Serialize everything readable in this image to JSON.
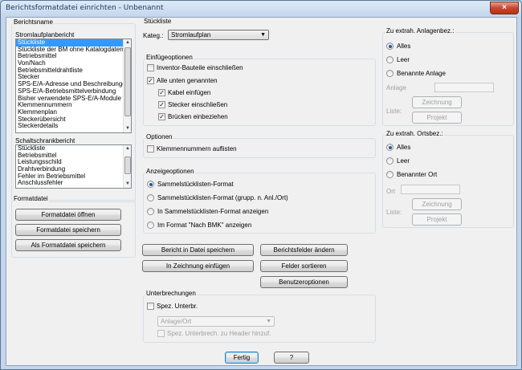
{
  "window": {
    "title": "Berichtsformatdatei einrichten - Unbenannt",
    "close_glyph": "×"
  },
  "left": {
    "report_name_group": "Berichtsname",
    "schematic_label": "Stromlaufplanbericht",
    "schematic_items": [
      "Stückliste",
      "Stückliste der BM ohne Katalogdaten",
      "Betriebsmittel",
      "Von/Nach",
      "Betriebsmitteldrahtliste",
      "Stecker",
      "SPS-E/A-Adresse und Beschreibungen",
      "SPS-E/A-Betriebsmittelverbindung",
      "Bisher verwendete SPS-E/A-Module",
      "Klemmennummern",
      "Klemmenplan",
      "Steckerübersicht",
      "Steckerdetails"
    ],
    "panel_label": "Schaltschrankbericht",
    "panel_items": [
      "Stückliste",
      "Betriebsmittel",
      "Leistungsschild",
      "Drahtverbindung",
      "Fehler im Betriebsmittel",
      "Anschlussfehler"
    ],
    "format_group": "Formatdatei",
    "open_label": "Formatdatei öffnen",
    "save_label": "Formatdatei speichern",
    "saveas_label": "Als Formatdatei speichern"
  },
  "middle": {
    "bom_group": "Stückliste",
    "category_label": "Kateg.:",
    "category_value": "Stromlaufplan",
    "insert_group": "Einfügeoptionen",
    "insert_options": [
      {
        "label": "Inventor-Bauteile einschließen",
        "checked": false
      },
      {
        "label": "Alle unten genannten",
        "checked": true
      },
      {
        "label": "Kabel einfügen",
        "checked": true
      },
      {
        "label": "Stecker einschließen",
        "checked": true
      },
      {
        "label": "Brücken einbeziehen",
        "checked": true
      }
    ],
    "options_group": "Optionen",
    "terminal_list_label": "Klemmennummern auflisten",
    "display_group": "Anzeigeoptionen",
    "display_options": [
      {
        "label": "Sammelstücklisten-Format",
        "selected": true
      },
      {
        "label": "Sammelstücklisten-Format (grupp. n. Anl./Ort)",
        "selected": false
      },
      {
        "label": "In Sammelstücklisten-Format anzeigen",
        "selected": false
      },
      {
        "label": "Im Format \"Nach BMK\" anzeigen",
        "selected": false
      }
    ],
    "save_report_label": "Bericht in Datei speichern",
    "change_fields_label": "Berichtsfelder ändern",
    "insert_drawing_label": "In Zeichnung einfügen",
    "sort_fields_label": "Felder sortieren",
    "user_options_label": "Benutzeroptionen",
    "breaks_group": "Unterbrechungen",
    "special_break_label": "Spez. Unterbr.",
    "break_combo_value": "Anlage/Ort",
    "header_break_label": "Spez. Unterbrech. zu Header hinzuf."
  },
  "right": {
    "install_group": "Zu extrah. Anlagenbez.:",
    "install_options": [
      "Alles",
      "Leer",
      "Benannte Anlage"
    ],
    "install_field_label": "Anlage",
    "install_list_label": "Liste:",
    "drawing_btn": "Zeichnung",
    "project_btn": "Projekt",
    "location_group": "Zu extrah. Ortsbez.:",
    "location_options": [
      "Alles",
      "Leer",
      "Benannter Ort"
    ],
    "location_field_label": "Ort",
    "location_list_label": "Liste:"
  },
  "footer": {
    "done_label": "Fertig",
    "help_label": "?"
  }
}
